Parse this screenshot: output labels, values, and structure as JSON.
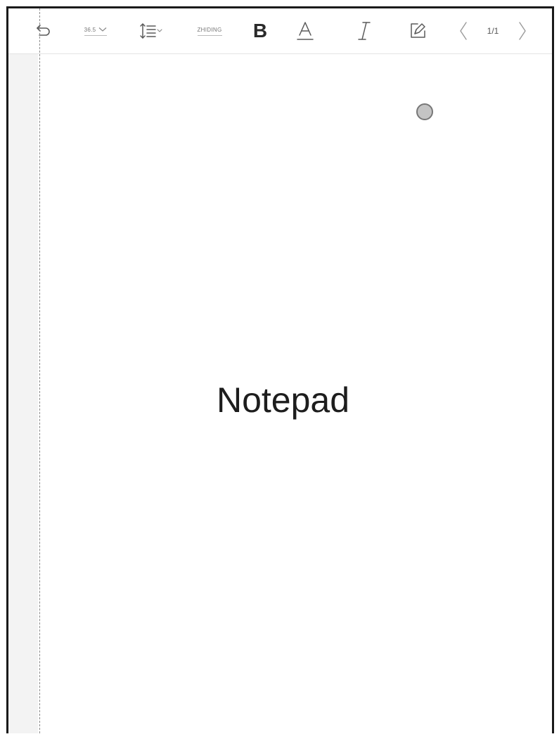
{
  "toolbar": {
    "undo_icon": "undo-icon",
    "font_size_value": "36.5",
    "font_size_dropdown_icon": "chevron-down-icon",
    "line_spacing_icon": "line-spacing-icon",
    "font_name_value": "ZHIDING",
    "bold_label": "B",
    "underline_icon": "underline-icon",
    "italic_icon": "italic-icon",
    "edit_icon": "edit-square-icon",
    "prev_icon": "chevron-left-icon",
    "page_indicator": "1/1",
    "next_icon": "chevron-right-icon"
  },
  "document": {
    "title": "Notepad"
  }
}
